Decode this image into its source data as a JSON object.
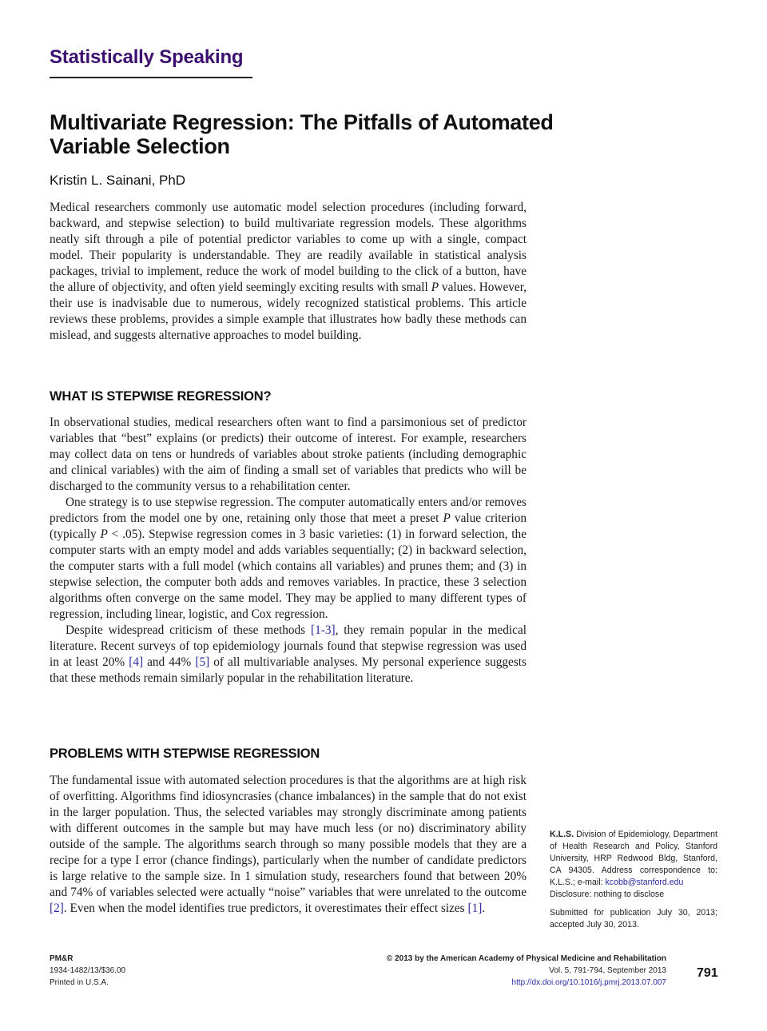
{
  "header": {
    "section_label": "Statistically Speaking"
  },
  "article": {
    "title": "Multivariate Regression: The Pitfalls of Automated Variable Selection",
    "author": "Kristin L. Sainani, PhD",
    "abstract": "Medical researchers commonly use automatic model selection procedures (including forward, backward, and stepwise selection) to build multivariate regression models. These algorithms neatly sift through a pile of potential predictor variables to come up with a single, compact model. Their popularity is understandable. They are readily available in statistical analysis packages, trivial to implement, reduce the work of model building to the click of a button, have the allure of objectivity, and often yield seemingly exciting results with small ",
    "abstract_italic": "P",
    "abstract_end": " values. However, their use is inadvisable due to numerous, widely recognized statistical problems. This article reviews these problems, provides a simple example that illustrates how badly these methods can mislead, and suggests alternative approaches to model building.",
    "sections": [
      {
        "heading": "WHAT IS STEPWISE REGRESSION?",
        "p1": "In observational studies, medical researchers often want to find a parsimonious set of predictor variables that “best” explains (or predicts) their outcome of interest. For example, researchers may collect data on tens or hundreds of variables about stroke patients (including demographic and clinical variables) with the aim of finding a small set of variables that predicts who will be discharged to the community versus to a rehabilitation center.",
        "p2_a": "One strategy is to use stepwise regression. The computer automatically enters and/or removes predictors from the model one by one, retaining only those that meet a preset ",
        "p2_i1": "P",
        "p2_b": " value criterion (typically ",
        "p2_i2": "P",
        "p2_c": " < .05). Stepwise regression comes in 3 basic varieties: (1) in forward selection, the computer starts with an empty model and adds variables sequentially; (2) in backward selection, the computer starts with a full model (which contains all variables) and prunes them; and (3) in stepwise selection, the computer both adds and removes variables. In practice, these 3 selection algorithms often converge on the same model. They may be applied to many different types of regression, including linear, logistic, and Cox regression.",
        "p3_a": "Despite widespread criticism of these methods ",
        "p3_ref1": "[1-3]",
        "p3_b": ", they remain popular in the medical literature. Recent surveys of top epidemiology journals found that stepwise regression was used in at least 20% ",
        "p3_ref2": "[4]",
        "p3_c": " and 44% ",
        "p3_ref3": "[5]",
        "p3_d": " of all multivariable analyses. My personal experience suggests that these methods remain similarly popular in the rehabilitation literature."
      },
      {
        "heading": "PROBLEMS WITH STEPWISE REGRESSION",
        "p1_a": "The fundamental issue with automated selection procedures is that the algorithms are at high risk of overfitting. Algorithms find idiosyncrasies (chance imbalances) in the sample that do not exist in the larger population. Thus, the selected variables may strongly discriminate among patients with different outcomes in the sample but may have much less (or no) discriminatory ability outside of the sample. The algorithms search through so many possible models that they are a recipe for a type I error (chance findings), particularly when the number of candidate predictors is large relative to the sample size. In 1 simulation study, researchers found that between 20% and 74% of variables selected were actually “noise” variables that were unrelated to the outcome ",
        "p1_ref1": "[2]",
        "p1_b": ". Even when the model identifies true predictors, it overestimates their effect sizes ",
        "p1_ref2": "[1]",
        "p1_c": "."
      }
    ]
  },
  "sidenote": {
    "initials": "K.L.S.",
    "affiliation": " Division of Epidemiology, Department of Health Research and Policy, Stanford University, HRP Redwood Bldg, Stanford, CA 94305. Address correspondence to: K.L.S.; e-mail: ",
    "email": "kcobb@stanford.edu",
    "disclosure": "Disclosure: nothing to disclose",
    "submitted": "Submitted for publication July 30, 2013; accepted July 30, 2013."
  },
  "footer": {
    "journal": "PM&R",
    "issn": "1934-1482/13/$36.00",
    "printed": "Printed in U.S.A.",
    "copyright": "© 2013 by the American Academy of Physical Medicine and Rehabilitation",
    "volume": "Vol. 5, 791-794, September 2013",
    "doi": "http://dx.doi.org/10.1016/j.pmrj.2013.07.007",
    "page_number": "791"
  },
  "colors": {
    "section_label": "#3b1070",
    "link": "#2a2aa0"
  }
}
